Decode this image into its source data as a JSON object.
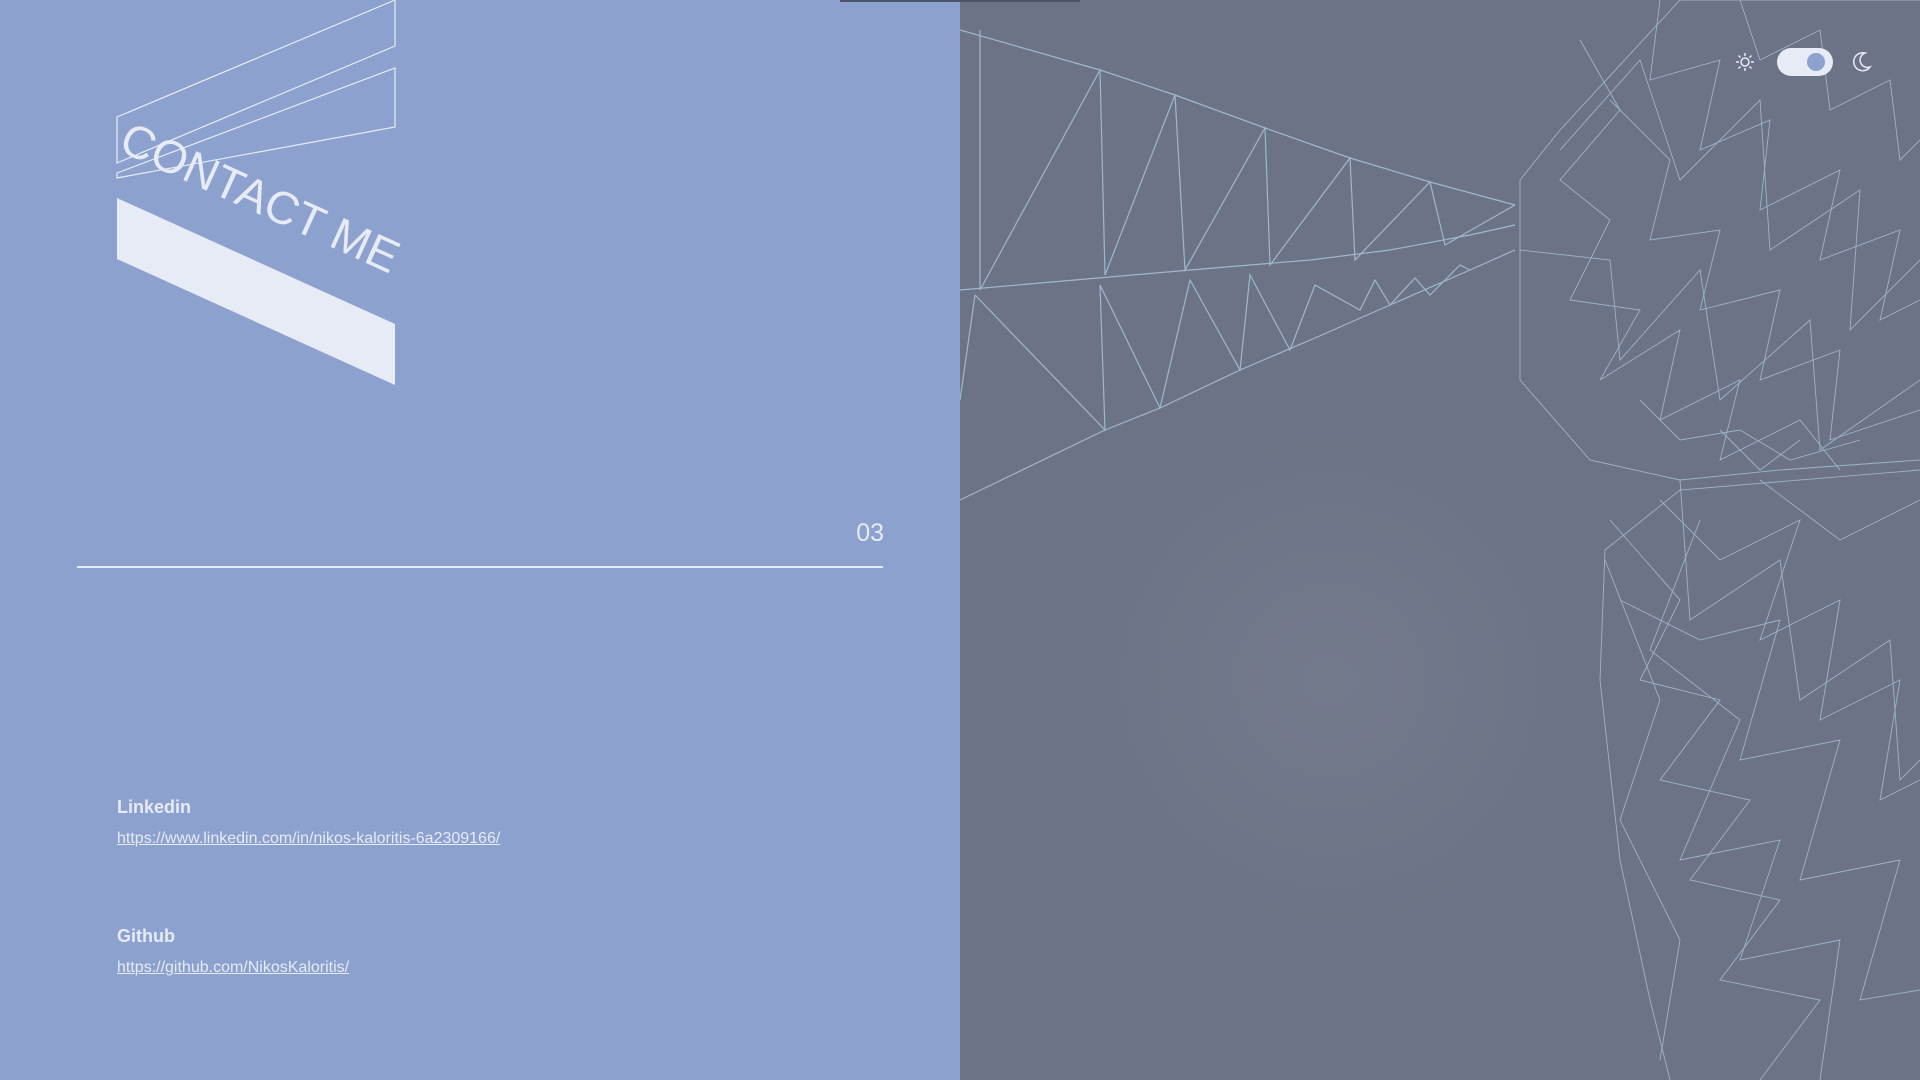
{
  "page": {
    "heading": "CONTACT ME",
    "section_number": "03"
  },
  "contacts": [
    {
      "label": "Linkedin",
      "url": "https://www.linkedin.com/in/nikos-kaloritis-6a2309166/"
    },
    {
      "label": "Github",
      "url": "https://github.com/NikosKaloritis/"
    }
  ],
  "theme_toggle": {
    "mode": "dark",
    "icons": [
      "sun-icon",
      "moon-icon"
    ]
  },
  "colors": {
    "left_panel": "#8ca1cd",
    "right_panel": "#6c7386",
    "text": "#e6ebf6",
    "wireframe": "#a6bed8"
  }
}
